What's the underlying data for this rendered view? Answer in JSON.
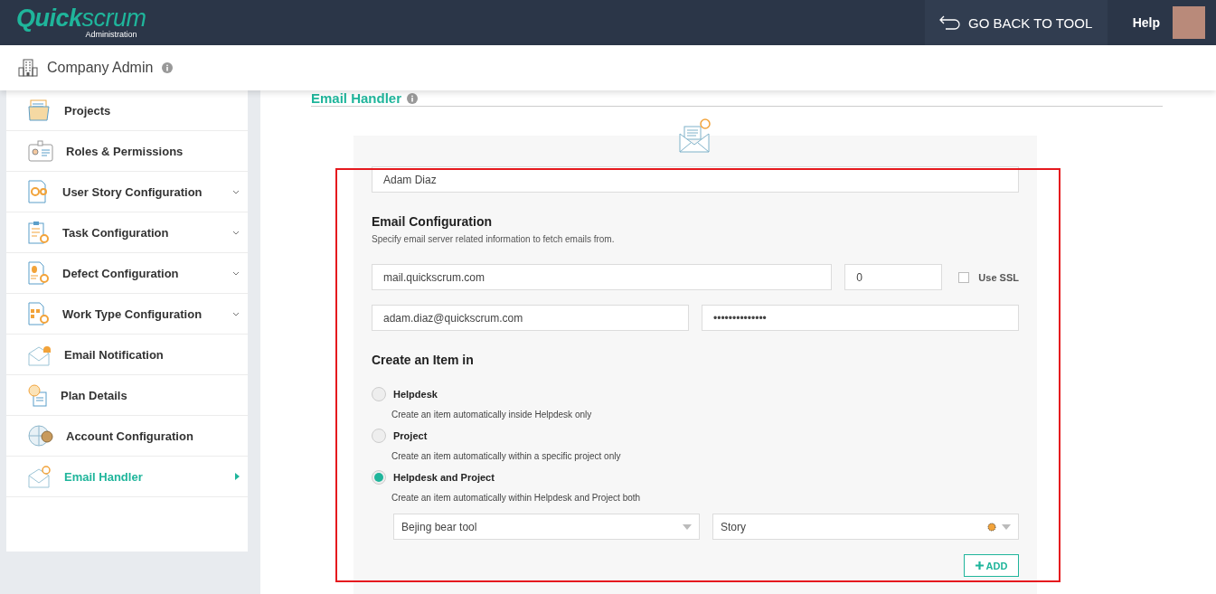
{
  "header": {
    "logo": "**Quick**scrum",
    "logo_subtitle": "Administration",
    "back_button": "GO BACK TO TOOL",
    "help": "Help"
  },
  "subheader": {
    "title": "Company Admin"
  },
  "sidebar": {
    "items": [
      {
        "label": "Projects",
        "expandable": false,
        "selected": false
      },
      {
        "label": "Roles & Permissions",
        "expandable": false,
        "selected": false
      },
      {
        "label": "User Story Configuration",
        "expandable": true,
        "selected": false
      },
      {
        "label": "Task Configuration",
        "expandable": true,
        "selected": false
      },
      {
        "label": "Defect Configuration",
        "expandable": true,
        "selected": false
      },
      {
        "label": "Work Type Configuration",
        "expandable": true,
        "selected": false
      },
      {
        "label": "Email Notification",
        "expandable": false,
        "selected": false
      },
      {
        "label": "Plan Details",
        "expandable": false,
        "selected": false
      },
      {
        "label": "Account Configuration",
        "expandable": false,
        "selected": false
      },
      {
        "label": "Email Handler",
        "expandable": false,
        "selected": true
      }
    ]
  },
  "page": {
    "title": "Email Handler"
  },
  "name_field": {
    "value": "Adam Diaz"
  },
  "email_config": {
    "title": "Email Configuration",
    "description": "Specify email server related information to fetch emails from.",
    "server": {
      "value": "mail.quickscrum.com"
    },
    "port": {
      "value": "0"
    },
    "use_ssl": {
      "label": "Use SSL",
      "checked": false
    },
    "username": {
      "value": "adam.diaz@quickscrum.com"
    },
    "password": {
      "value": "••••••••••••••"
    }
  },
  "create_item": {
    "title": "Create an Item in",
    "options": [
      {
        "label": "Helpdesk",
        "description": "Create an item automatically inside Helpdesk only",
        "selected": false
      },
      {
        "label": "Project",
        "description": "Create an item automatically within a specific project only",
        "selected": false
      },
      {
        "label": "Helpdesk and Project",
        "description": "Create an item automatically within Helpdesk and Project both",
        "selected": true
      }
    ],
    "project_select": {
      "value": "Bejing bear tool"
    },
    "type_select": {
      "value": "Story"
    },
    "add_button": {
      "label": "ADD"
    }
  }
}
